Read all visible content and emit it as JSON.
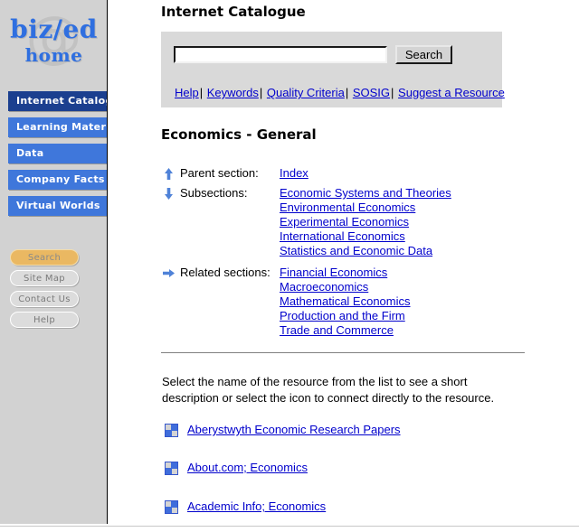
{
  "sidebar": {
    "logo": {
      "main": "biz/ed",
      "sub": "home",
      "watermark": "@"
    },
    "nav_items": [
      {
        "label": "Internet Catalogue",
        "active": true
      },
      {
        "label": "Learning Materials",
        "active": false
      },
      {
        "label": "Data",
        "active": false
      },
      {
        "label": "Company Facts",
        "active": false
      },
      {
        "label": "Virtual Worlds",
        "active": false
      }
    ],
    "util_items": [
      {
        "label": "Search",
        "highlight": true
      },
      {
        "label": "Site Map",
        "highlight": false
      },
      {
        "label": "Contact Us",
        "highlight": false
      },
      {
        "label": "Help",
        "highlight": false
      }
    ]
  },
  "header": {
    "title": "Internet Catalogue"
  },
  "search": {
    "value": "",
    "placeholder": "",
    "button_label": "Search",
    "quick_links": [
      "Help",
      "Keywords",
      "Quality Criteria",
      "SOSIG",
      "Suggest a Resource"
    ],
    "separator": "|"
  },
  "section": {
    "title": "Economics - General",
    "groups": [
      {
        "icon": "arrow-up-icon",
        "label": "Parent section:",
        "links": [
          "Index"
        ]
      },
      {
        "icon": "arrow-down-icon",
        "label": "Subsections:",
        "links": [
          "Economic Systems and Theories",
          "Environmental Economics",
          "Experimental Economics",
          "International Economics",
          "Statistics and Economic Data"
        ]
      },
      {
        "icon": "arrow-right-icon",
        "label": "Related sections:",
        "links": [
          "Financial Economics",
          "Macroeconomics",
          "Mathematical Economics",
          "Production and the Firm",
          "Trade and Commerce"
        ]
      }
    ]
  },
  "resources": {
    "instructions": "Select the name of the resource from the list to see a short description or select the icon to connect directly to the resource.",
    "items": [
      "Aberystwyth Economic Research Papers",
      "About.com; Economics",
      "Academic Info; Economics"
    ]
  },
  "colors": {
    "sidebar_bg": "#d2d2d2",
    "nav_active": "#1b3f8f",
    "nav_inactive": "#3f77db",
    "util_highlight": "#eab862",
    "link": "#0000cc",
    "panel_bg": "#d9d9d9",
    "logo": "#2f6fe0"
  }
}
